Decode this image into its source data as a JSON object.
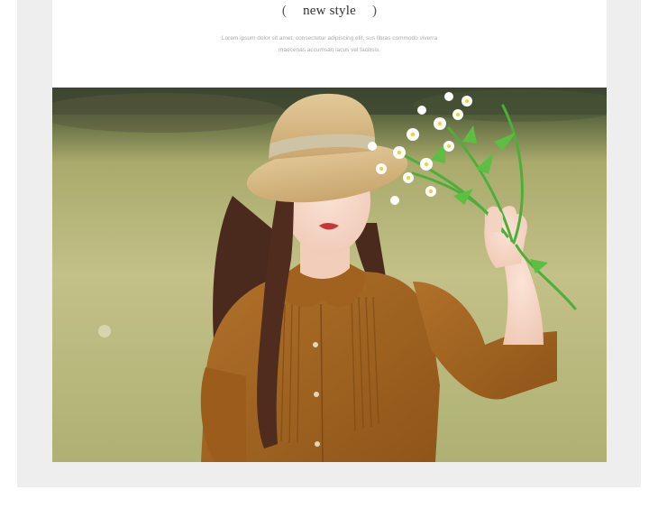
{
  "header": {
    "open_paren": "(",
    "title": "new style",
    "close_paren": ")",
    "subtitle_line1": "Lorem ipsum dolor sit amet, consectetur adipiscing elit, sus libras commodo viverra",
    "subtitle_line2": "maecenas accumsan lacus vel facilisis."
  },
  "photo": {
    "subject": "woman-in-straw-hat-holding-daisies",
    "colors": {
      "grass": "#b9b67c",
      "dress": "#a8651e",
      "hat": "#d9bd8b",
      "hair": "#4a2a1c",
      "leaves": "#4caf3a"
    }
  }
}
